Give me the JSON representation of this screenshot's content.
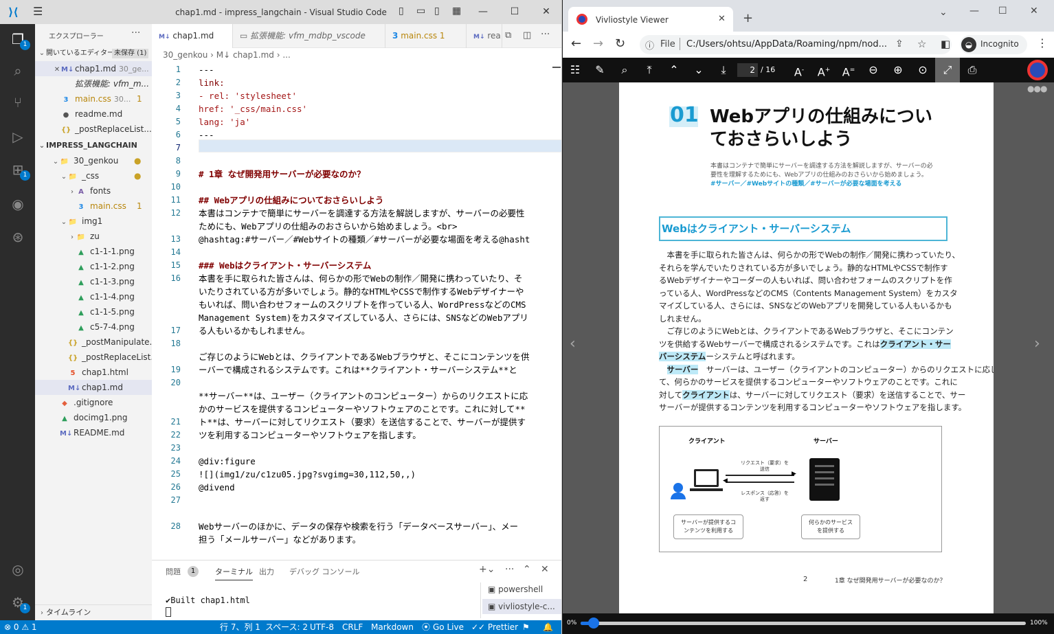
{
  "vscode": {
    "title": "chap1.md - impress_langchain - Visual Studio Code",
    "activity_badges": [
      "1",
      "1",
      "1"
    ],
    "sidebar": {
      "header": "エクスプローラー",
      "open_editors_label": "開いているエディター",
      "unsaved_badge": "未保存 (1)",
      "open_editors": [
        {
          "name": "chap1.md",
          "hint": "30_ge...",
          "icon": "M↓"
        },
        {
          "name": "拡張機能: vfm_m...",
          "hint": "",
          "icon": ""
        },
        {
          "name": "main.css",
          "hint": "30...",
          "icon": "3",
          "count": "1"
        },
        {
          "name": "readme.md",
          "hint": "",
          "icon": "●"
        },
        {
          "name": "_postReplaceList...",
          "hint": "",
          "icon": "{}"
        }
      ],
      "workspace": "IMPRESS_LANGCHAIN",
      "tree": [
        {
          "name": "30_genkou",
          "icon": "📁",
          "indent": 1,
          "chev": "⌄"
        },
        {
          "name": "_css",
          "icon": "📁",
          "indent": 2,
          "chev": "⌄"
        },
        {
          "name": "fonts",
          "icon": "A",
          "indent": 3,
          "chev": "›"
        },
        {
          "name": "main.css",
          "icon": "3",
          "indent": 3,
          "chev": "",
          "count": "1"
        },
        {
          "name": "img1",
          "icon": "📁",
          "indent": 2,
          "chev": "⌄"
        },
        {
          "name": "zu",
          "icon": "📁",
          "indent": 3,
          "chev": "›"
        },
        {
          "name": "c1-1-1.png",
          "icon": "▲",
          "indent": 3,
          "chev": ""
        },
        {
          "name": "c1-1-2.png",
          "icon": "▲",
          "indent": 3,
          "chev": ""
        },
        {
          "name": "c1-1-3.png",
          "icon": "▲",
          "indent": 3,
          "chev": ""
        },
        {
          "name": "c1-1-4.png",
          "icon": "▲",
          "indent": 3,
          "chev": ""
        },
        {
          "name": "c1-1-5.png",
          "icon": "▲",
          "indent": 3,
          "chev": ""
        },
        {
          "name": "c5-7-4.png",
          "icon": "▲",
          "indent": 3,
          "chev": ""
        },
        {
          "name": "_postManipulate...",
          "icon": "{}",
          "indent": 2,
          "chev": ""
        },
        {
          "name": "_postReplaceList...",
          "icon": "{}",
          "indent": 2,
          "chev": ""
        },
        {
          "name": "chap1.html",
          "icon": "5",
          "indent": 2,
          "chev": ""
        },
        {
          "name": "chap1.md",
          "icon": "M↓",
          "indent": 2,
          "chev": ""
        },
        {
          "name": ".gitignore",
          "icon": "◆",
          "indent": 1,
          "chev": ""
        },
        {
          "name": "docimg1.png",
          "icon": "▲",
          "indent": 1,
          "chev": ""
        },
        {
          "name": "README.md",
          "icon": "M↓",
          "indent": 1,
          "chev": ""
        }
      ],
      "timeline": "タイムライン"
    },
    "tabs": [
      {
        "label": "chap1.md",
        "icon": "M↓"
      },
      {
        "label": "拡張機能: vfm_mdbp_vscode",
        "icon": ""
      },
      {
        "label": "main.css 1",
        "icon": "3"
      },
      {
        "label": "rea",
        "icon": "M↓"
      }
    ],
    "breadcrumb": "30_genkou  ›  M↓ chap1.md  ›  ...",
    "line_numbers": [
      "1",
      "2",
      "3",
      "4",
      "5",
      "6",
      "7",
      "8",
      "9",
      "10",
      "11",
      "12",
      "",
      "13",
      "14",
      "15",
      "16",
      "",
      "",
      "",
      "17",
      "18",
      "",
      "19",
      "20",
      "",
      "",
      "21",
      "22",
      "23",
      "24",
      "25",
      "26",
      "27",
      "",
      "28"
    ],
    "code": [
      {
        "t": "---",
        "c": ""
      },
      {
        "t": "link:",
        "c": "k"
      },
      {
        "t": "  - rel: 'stylesheet'",
        "c": "s"
      },
      {
        "t": "    href: '_css/main.css'",
        "c": "s"
      },
      {
        "t": "lang: 'ja'",
        "c": "s"
      },
      {
        "t": "---",
        "c": ""
      },
      {
        "t": "",
        "c": ""
      },
      {
        "t": "",
        "c": ""
      },
      {
        "t": "# 1章 なぜ開発用サーバーが必要なのか？",
        "c": "h"
      },
      {
        "t": "",
        "c": ""
      },
      {
        "t": "## Webアプリの仕組みについておさらいしよう",
        "c": "h"
      },
      {
        "t": "本書はコンテナで簡単にサーバーを調達する方法を解説しますが、サーバーの必要性",
        "c": ""
      },
      {
        "t": "ためにも、Webアプリの仕組みのおさらいから始めましょう。<br>",
        "c": ""
      },
      {
        "t": "@hashtag:#サーバー／#Webサイトの種類／#サーバーが必要な場面を考える@hasht",
        "c": ""
      },
      {
        "t": "",
        "c": ""
      },
      {
        "t": "### Webはクライアント・サーバーシステム",
        "c": "h"
      },
      {
        "t": "本書を手に取られた皆さんは、何らかの形でWebの制作／開発に携わっていたり、そ",
        "c": ""
      },
      {
        "t": "いたりされている方が多いでしょう。静的なHTMLやCSSで制作するWebデザイナーや",
        "c": ""
      },
      {
        "t": "もいれば、問い合わせフォームのスクリプトを作っている人、WordPressなどのCMS",
        "c": ""
      },
      {
        "t": "Management System)をカスタマイズしている人、さらには、SNSなどのWebアプリ",
        "c": ""
      },
      {
        "t": "る人もいるかもしれません。",
        "c": ""
      },
      {
        "t": "",
        "c": ""
      },
      {
        "t": "ご存じのようにWebとは、クライアントであるWebブラウザと、そこにコンテンツを供",
        "c": ""
      },
      {
        "t": "ーバーで構成されるシステムです。これは**クライアント・サーバーシステム**と",
        "c": ""
      },
      {
        "t": "",
        "c": ""
      },
      {
        "t": "**サーバー**は、ユーザー（クライアントのコンピューター）からのリクエストに応",
        "c": ""
      },
      {
        "t": "かのサービスを提供するコンピューターやソフトウェアのことです。これに対して**",
        "c": ""
      },
      {
        "t": "ト**は、サーバーに対してリクエスト（要求）を送信することで、サーバーが提供す",
        "c": ""
      },
      {
        "t": "ツを利用するコンピューターやソフトウェアを指します。",
        "c": ""
      },
      {
        "t": "",
        "c": ""
      },
      {
        "t": "@div:figure",
        "c": ""
      },
      {
        "t": "![](img1/zu/c1zu05.jpg?svgimg=30,112,50,,)",
        "c": ""
      },
      {
        "t": "@divend",
        "c": ""
      },
      {
        "t": "",
        "c": ""
      },
      {
        "t": "",
        "c": ""
      },
      {
        "t": "Webサーバーのほかに、データの保存や検索を行う「データベースサーバー」、メー",
        "c": ""
      },
      {
        "t": "担う「メールサーバー」などがあります。",
        "c": ""
      },
      {
        "t": "",
        "c": ""
      }
    ],
    "panel": {
      "tabs": [
        "問題",
        "ターミナル",
        "出力",
        "デバッグ コンソール"
      ],
      "problems_count": "1",
      "terminal_output": "✔Built chap1.html",
      "terminals": [
        "powershell",
        "vivliostyle-c..."
      ]
    },
    "status": {
      "errors": "⊗ 0 ⚠ 1",
      "position": "行 7、列 1",
      "spaces": "スペース: 2",
      "encoding": "UTF-8",
      "eol": "CRLF",
      "language": "Markdown",
      "golive": "Go Live",
      "prettier": "✓✓ Prettier"
    }
  },
  "browser": {
    "tab_title": "Vivliostyle Viewer",
    "url_scheme": "File",
    "url": "C:/Users/ohtsu/AppData/Roaming/npm/nod...",
    "incognito": "Incognito",
    "page_indicator": "2",
    "page_total": "/ 16",
    "progress_left": "0%",
    "progress_right": "100%",
    "progress_fraction": 0.03
  },
  "doc": {
    "chapter_no": "01",
    "title_line1": "Webアプリの仕組みについ",
    "title_line2": "ておさらいしよう",
    "lead1": "本書はコンテナで簡単にサーバーを調達する方法を解説しますが、サーバーの必",
    "lead2": "要性を理解するためにも、Webアプリの仕組みのおさらいから始めましょう。",
    "tags": "#サーバー／#Webサイトの種類／#サーバーが必要な場面を考える",
    "section": "Webはクライアント・サーバーシステム",
    "body": [
      "　本書を手に取られた皆さんは、何らかの形でWebの制作／開発に携わっていたり、",
      "それらを学んでいたりされている方が多いでしょう。静的なHTMLやCSSで制作す",
      "るWebデザイナーやコーダーの人もいれば、問い合わせフォームのスクリプトを作",
      "っている人、WordPressなどのCMS（Contents Management System）をカスタ",
      "マイズしている人、さらには、SNSなどのWebアプリを開発している人もいるかも",
      "しれません。",
      "　ご存じのようにWebとは、クライアントであるWebブラウザと、そこにコンテン",
      "ツを供給するWebサーバーで構成されるシステムです。これは",
      "ーシステムと呼ばれます。",
      "　サーバーは、ユーザー（クライアントのコンピューター）からのリクエストに応じ",
      "て、何らかのサービスを提供するコンピューターやソフトウェアのことです。これに",
      "対して",
      "サーバーが提供するコンテンツを利用するコンピューターやソフトウェアを指します。"
    ],
    "hl_cs1": "クライアント・サー",
    "hl_cs2": "バーシステム",
    "hl_server": "サーバー",
    "hl_client": "クライアント",
    "body_b": "は、サーバーに対してリクエスト（要求）を送信することで、サー",
    "figure": {
      "client": "クライアント",
      "server": "サーバー",
      "req1": "リクエスト（要求）を",
      "req2": "送信",
      "res1": "レスポンス（応答）を",
      "res2": "返す",
      "bubble_left1": "サーバーが提供するコ",
      "bubble_left2": "ンテンツを利用する",
      "bubble_right1": "何らかのサービス",
      "bubble_right2": "を提供する"
    },
    "page_number": "2",
    "running_head": "1章 なぜ開発用サーバーが必要なのか？"
  },
  "colors": {
    "accent": "#007acc",
    "highlight": "#bde9f7",
    "chapter": "#1a9bd1",
    "box": "#4cb5d6"
  }
}
